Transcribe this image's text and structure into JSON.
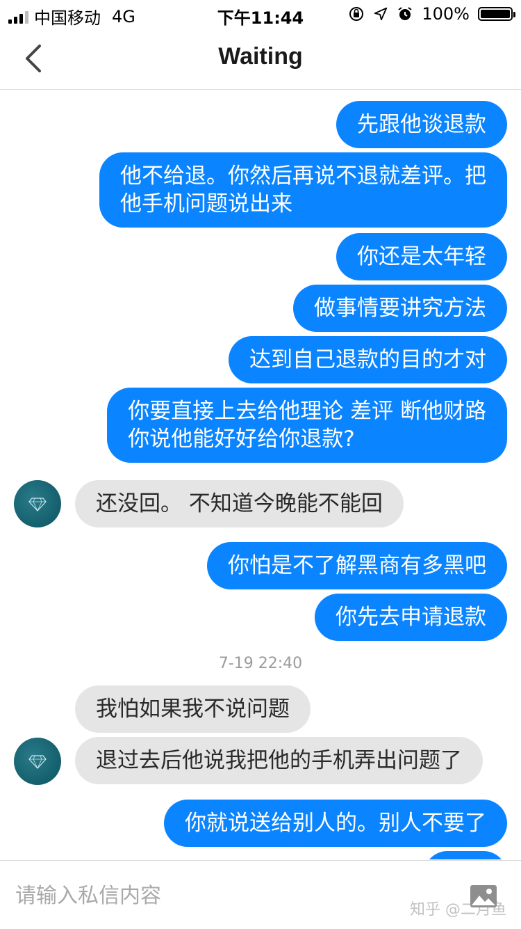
{
  "status_bar": {
    "carrier": "中国移动",
    "network": "4G",
    "time": "下午11:44",
    "battery": "100%",
    "battery_level": 1.0
  },
  "nav": {
    "title": "Waiting",
    "back_icon": "chevron-left-icon"
  },
  "messages": [
    {
      "side": "out",
      "lines": [
        "先跟他谈退款"
      ]
    },
    {
      "side": "out",
      "lines": [
        "他不给退。你然后再说不退就差评。把",
        "他手机问题说出来"
      ]
    },
    {
      "side": "out",
      "lines": [
        "你还是太年轻"
      ]
    },
    {
      "side": "out",
      "lines": [
        "做事情要讲究方法"
      ]
    },
    {
      "side": "out",
      "lines": [
        "达到自己退款的目的才对"
      ]
    },
    {
      "side": "out",
      "lines": [
        "你要直接上去给他理论 差评 断他财路",
        "你说他能好好给你退款?"
      ]
    },
    {
      "side": "in",
      "lines": [
        "还没回。 不知道今晚能不能回"
      ]
    },
    {
      "side": "out",
      "lines": [
        "你怕是不了解黑商有多黑吧"
      ]
    },
    {
      "side": "out",
      "lines": [
        "你先去申请退款"
      ]
    },
    {
      "side": "in",
      "lines": [
        "我怕如果我不说问题"
      ]
    },
    {
      "side": "in",
      "lines": [
        "退过去后他说我把他的手机弄出问题了"
      ]
    },
    {
      "side": "out",
      "lines": [
        "你就说送给别人的。别人不要了"
      ]
    }
  ],
  "timestamp": "7-19 22:40",
  "input": {
    "placeholder": "请输入私信内容",
    "image_icon": "image-icon"
  },
  "watermark": "知乎 @二月鱼",
  "colors": {
    "outgoing_bubble": "#0a84ff",
    "incoming_bubble": "#e5e5e5",
    "avatar": "#1a6a78"
  }
}
